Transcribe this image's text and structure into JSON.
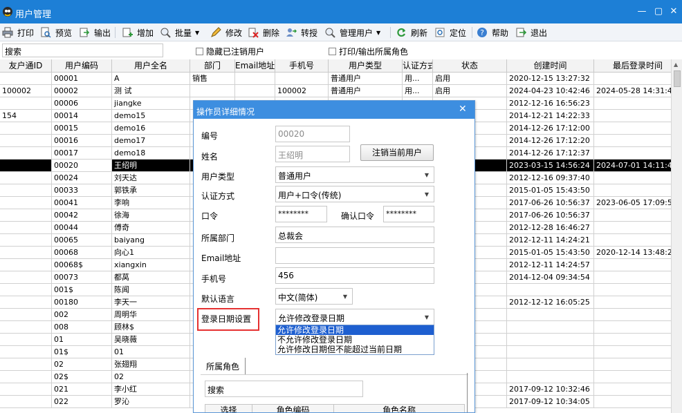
{
  "window": {
    "title": "用户管理",
    "icon": "app-logo-icon"
  },
  "toolbar": {
    "items": [
      {
        "label": "打印",
        "icon": "printer-icon"
      },
      {
        "label": "预览",
        "icon": "preview-icon"
      },
      {
        "label": "输出",
        "icon": "export-icon"
      },
      {
        "label": "增加",
        "icon": "add-icon"
      },
      {
        "label": "批量",
        "icon": "batch-icon"
      },
      {
        "label": "修改",
        "icon": "edit-icon"
      },
      {
        "label": "删除",
        "icon": "delete-icon"
      },
      {
        "label": "转授",
        "icon": "delegate-icon"
      },
      {
        "label": "管理用户",
        "icon": "manage-users-icon"
      },
      {
        "label": "刷新",
        "icon": "refresh-icon"
      },
      {
        "label": "定位",
        "icon": "locate-icon"
      },
      {
        "label": "帮助",
        "icon": "help-icon"
      },
      {
        "label": "退出",
        "icon": "exit-icon"
      }
    ]
  },
  "filter": {
    "search": "搜索",
    "hide_cancelled": "隐藏已注销用户",
    "print_roles": "打印/输出所属角色"
  },
  "grid": {
    "columns": [
      "友户通ID",
      "用户编码",
      "用户全名",
      "部门",
      "Email地址",
      "手机号",
      "用户类型",
      "认证方式",
      "状态",
      "创建时间",
      "最后登录时间"
    ],
    "rows": [
      [
        "",
        "00001",
        "A",
        "销售",
        "",
        "",
        "普通用户",
        "用...",
        "启用",
        "2020-12-15 13:27:32",
        ""
      ],
      [
        "100002",
        "00002",
        "测 试",
        "",
        "",
        "100002",
        "普通用户",
        "用...",
        "启用",
        "2024-04-23 10:42:46",
        "2024-05-28 14:31:4"
      ],
      [
        "",
        "00006",
        "jiangke",
        "",
        "",
        "",
        "",
        "",
        "",
        "2012-12-16 16:56:23",
        ""
      ],
      [
        "154",
        "00014",
        "demo15",
        "",
        "",
        "",
        "",
        "",
        "",
        "2014-12-21 14:22:33",
        ""
      ],
      [
        "",
        "00015",
        "demo16",
        "",
        "",
        "",
        "",
        "",
        "",
        "2014-12-26 17:12:00",
        ""
      ],
      [
        "",
        "00016",
        "demo17",
        "",
        "",
        "",
        "",
        "",
        "",
        "2014-12-26 17:12:20",
        ""
      ],
      [
        "",
        "00017",
        "demo18",
        "",
        "",
        "",
        "",
        "",
        "",
        "2014-12-26 17:12:37",
        ""
      ],
      [
        "",
        "00020",
        "王绍明",
        "",
        "",
        "",
        "",
        "",
        "",
        "2023-03-15 14:56:24",
        "2024-07-01 14:11:4"
      ],
      [
        "",
        "00024",
        "刘天达",
        "",
        "",
        "",
        "",
        "",
        "",
        "2012-12-16 09:37:40",
        ""
      ],
      [
        "",
        "00033",
        "郭铁承",
        "",
        "",
        "",
        "",
        "",
        "",
        "2015-01-05 15:43:50",
        ""
      ],
      [
        "",
        "00041",
        "李响",
        "",
        "",
        "",
        "",
        "",
        "",
        "2017-06-26 10:56:37",
        "2023-06-05 17:09:5"
      ],
      [
        "",
        "00042",
        "徐海",
        "",
        "",
        "",
        "",
        "",
        "",
        "2017-06-26 10:56:37",
        ""
      ],
      [
        "",
        "00044",
        "傅奇",
        "",
        "",
        "",
        "",
        "",
        "",
        "2012-12-28 16:46:27",
        ""
      ],
      [
        "",
        "00065",
        "baiyang",
        "",
        "",
        "",
        "",
        "",
        "",
        "2012-12-11 14:24:21",
        ""
      ],
      [
        "",
        "00068",
        "向心1",
        "",
        "",
        "",
        "",
        "",
        "",
        "2015-01-05 15:43:50",
        "2020-12-14 13:48:2"
      ],
      [
        "",
        "00068$",
        "xiangxin",
        "",
        "",
        "",
        "",
        "",
        "",
        "2012-12-11 14:24:57",
        ""
      ],
      [
        "",
        "00073",
        "都莴",
        "",
        "",
        "",
        "",
        "",
        "",
        "2014-12-04 09:34:54",
        ""
      ],
      [
        "",
        "001$",
        "陈闻",
        "",
        "",
        "",
        "",
        "",
        "",
        "",
        ""
      ],
      [
        "",
        "00180",
        "李天一",
        "",
        "",
        "",
        "",
        "",
        "",
        "2012-12-12 16:05:25",
        ""
      ],
      [
        "",
        "002",
        "周明华",
        "",
        "",
        "",
        "",
        "",
        "",
        "",
        ""
      ],
      [
        "",
        "008",
        "顾林$",
        "",
        "",
        "",
        "",
        "",
        "",
        "",
        ""
      ],
      [
        "",
        "01",
        "吴晓薇",
        "",
        "",
        "",
        "",
        "",
        "",
        "",
        ""
      ],
      [
        "",
        "01$",
        "01",
        "",
        "",
        "",
        "",
        "",
        "",
        "",
        ""
      ],
      [
        "",
        "02",
        "张翅翔",
        "",
        "",
        "",
        "",
        "",
        "",
        "",
        ""
      ],
      [
        "",
        "02$",
        "02",
        "",
        "",
        "",
        "",
        "",
        "",
        "",
        ""
      ],
      [
        "",
        "021",
        "李小红",
        "",
        "",
        "",
        "",
        "",
        "",
        "2017-09-12 10:32:46",
        ""
      ],
      [
        "",
        "022",
        "罗沁",
        "",
        "",
        "",
        "",
        "",
        "",
        "2017-09-12 10:34:05",
        ""
      ]
    ],
    "selected_row": 7
  },
  "dialog": {
    "title": "操作员详细情况",
    "labels": {
      "code": "编号",
      "name": "姓名",
      "user_type": "用户类型",
      "auth": "认证方式",
      "password": "口令",
      "confirm_password": "确认口令",
      "dept": "所属部门",
      "email": "Email地址",
      "phone": "手机号",
      "language": "默认语言",
      "login_date": "登录日期设置"
    },
    "values": {
      "code": "00020",
      "name": "王绍明",
      "user_type": "普通用户",
      "auth": "用户+口令(传统)",
      "password": "********",
      "confirm_password": "********",
      "dept": "总裁会",
      "email": "",
      "phone": "456",
      "language": "中文(简体)",
      "login_date": "允许修改登录日期"
    },
    "cancel_user_button": "注销当前用户",
    "login_date_options": [
      "允许修改登录日期",
      "不允许修改登录日期",
      "允许修改日期但不能超过当前日期"
    ],
    "roles_tab": "所属角色",
    "roles_search": "搜索",
    "roles_columns": [
      "选择",
      "角色编码",
      "角色名称"
    ]
  }
}
